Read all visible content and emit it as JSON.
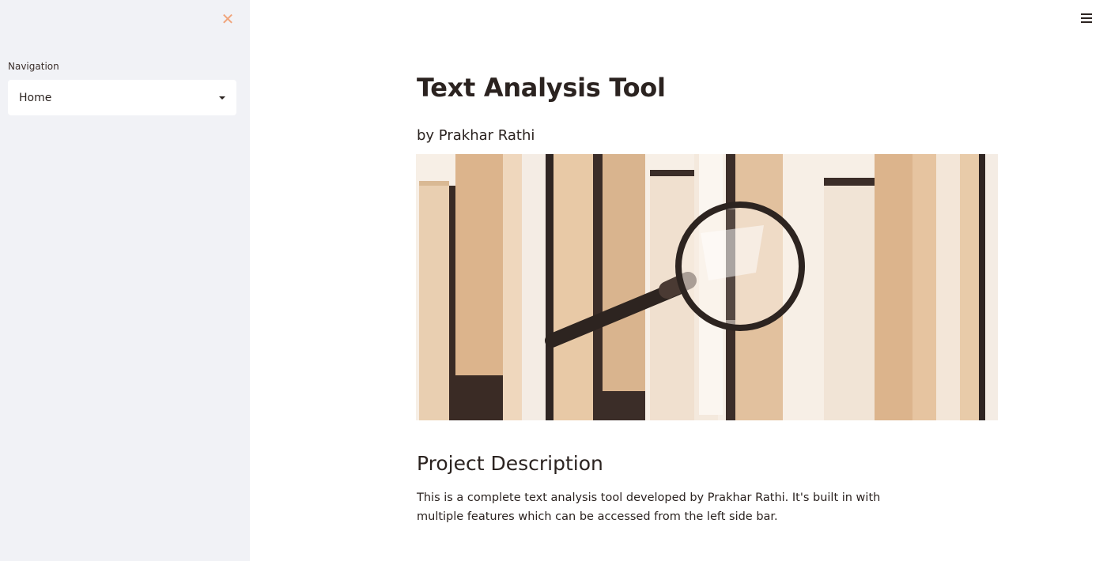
{
  "sidebar": {
    "close_icon": "close-icon",
    "navigation_label": "Navigation",
    "navigation_selected": "Home"
  },
  "header": {
    "menu_icon": "hamburger-menu-icon"
  },
  "main": {
    "title": "Text Analysis Tool",
    "subtitle": "by Prakhar Rathi",
    "hero_image": "books-with-magnifying-glass",
    "section_title": "Project Description",
    "description": "This is a complete text analysis tool developed by Prakhar Rathi. It's built in with multiple features which can be accessed from the left side bar."
  },
  "colors": {
    "accent": "#f0a57c",
    "sidebar_bg": "#f1f2f6",
    "text": "#2b2320"
  }
}
